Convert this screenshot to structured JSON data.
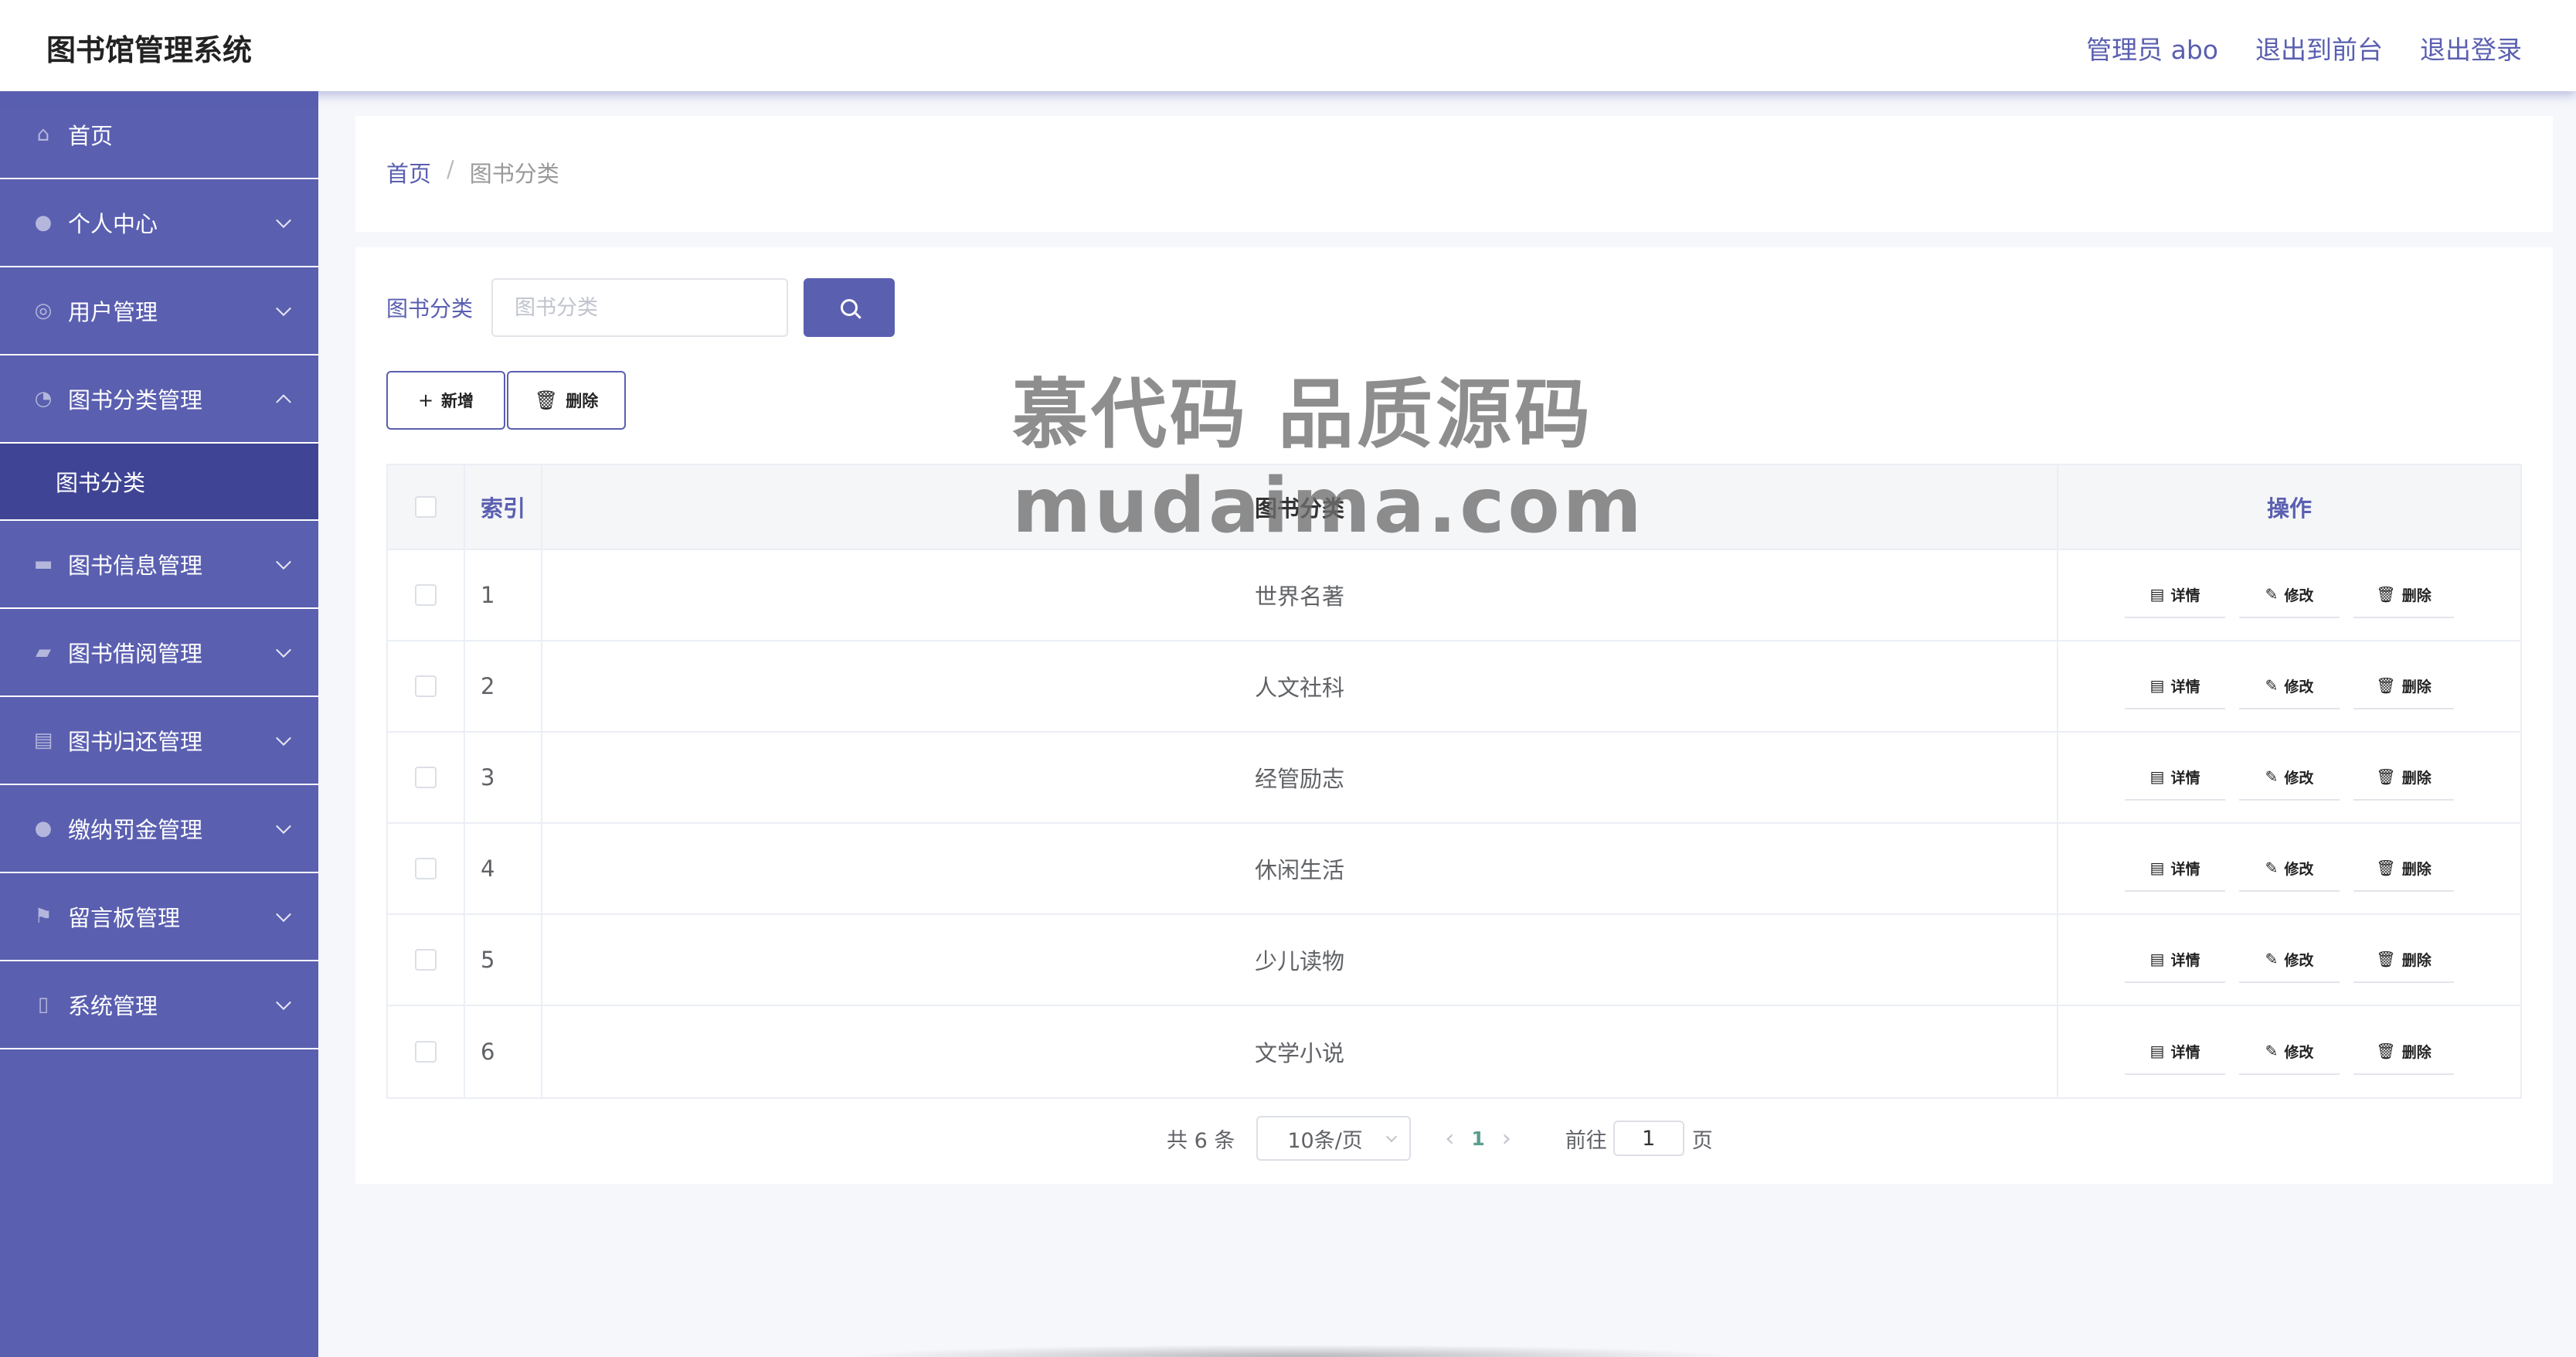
{
  "header": {
    "title": "图书馆管理系统",
    "admin_label": "管理员 abo",
    "front_label": "退出到前台",
    "logout_label": "退出登录"
  },
  "sidebar": {
    "items": [
      {
        "label": "首页",
        "icon": "home-icon"
      },
      {
        "label": "个人中心",
        "icon": "user-icon"
      },
      {
        "label": "用户管理",
        "icon": "lifebuoy-icon"
      },
      {
        "label": "图书分类管理",
        "icon": "compass-icon",
        "expanded": true
      },
      {
        "label": "图书信息管理",
        "icon": "chat-icon"
      },
      {
        "label": "图书借阅管理",
        "icon": "ticket-icon"
      },
      {
        "label": "图书归还管理",
        "icon": "briefcase-icon"
      },
      {
        "label": "缴纳罚金管理",
        "icon": "bulb-icon"
      },
      {
        "label": "留言板管理",
        "icon": "flag-icon"
      },
      {
        "label": "系统管理",
        "icon": "phone-icon"
      }
    ],
    "submenu": {
      "label": "图书分类"
    }
  },
  "breadcrumb": {
    "home": "首页",
    "separator": "/",
    "current": "图书分类"
  },
  "search": {
    "label": "图书分类",
    "placeholder": "图书分类",
    "value": ""
  },
  "actions": {
    "add_label": "新增",
    "delete_label": "删除"
  },
  "table": {
    "headers": {
      "index": "索引",
      "name": "图书分类",
      "ops": "操作"
    },
    "op_labels": {
      "detail": "详情",
      "edit": "修改",
      "delete": "删除"
    },
    "rows": [
      {
        "index": "1",
        "name": "世界名著"
      },
      {
        "index": "2",
        "name": "人文社科"
      },
      {
        "index": "3",
        "name": "经管励志"
      },
      {
        "index": "4",
        "name": "休闲生活"
      },
      {
        "index": "5",
        "name": "少儿读物"
      },
      {
        "index": "6",
        "name": "文学小说"
      }
    ]
  },
  "pagination": {
    "total": "共 6 条",
    "page_size": "10条/页",
    "current_page": "1",
    "goto_label": "前往",
    "goto_value": "1",
    "unit": "页"
  },
  "watermark": {
    "line1": "慕代码 品质源码",
    "line2": "mudaima.com"
  },
  "colors": {
    "accent": "#5a5fb0",
    "submenu_active": "#3f4494",
    "page_number": "#5a9e8f"
  }
}
